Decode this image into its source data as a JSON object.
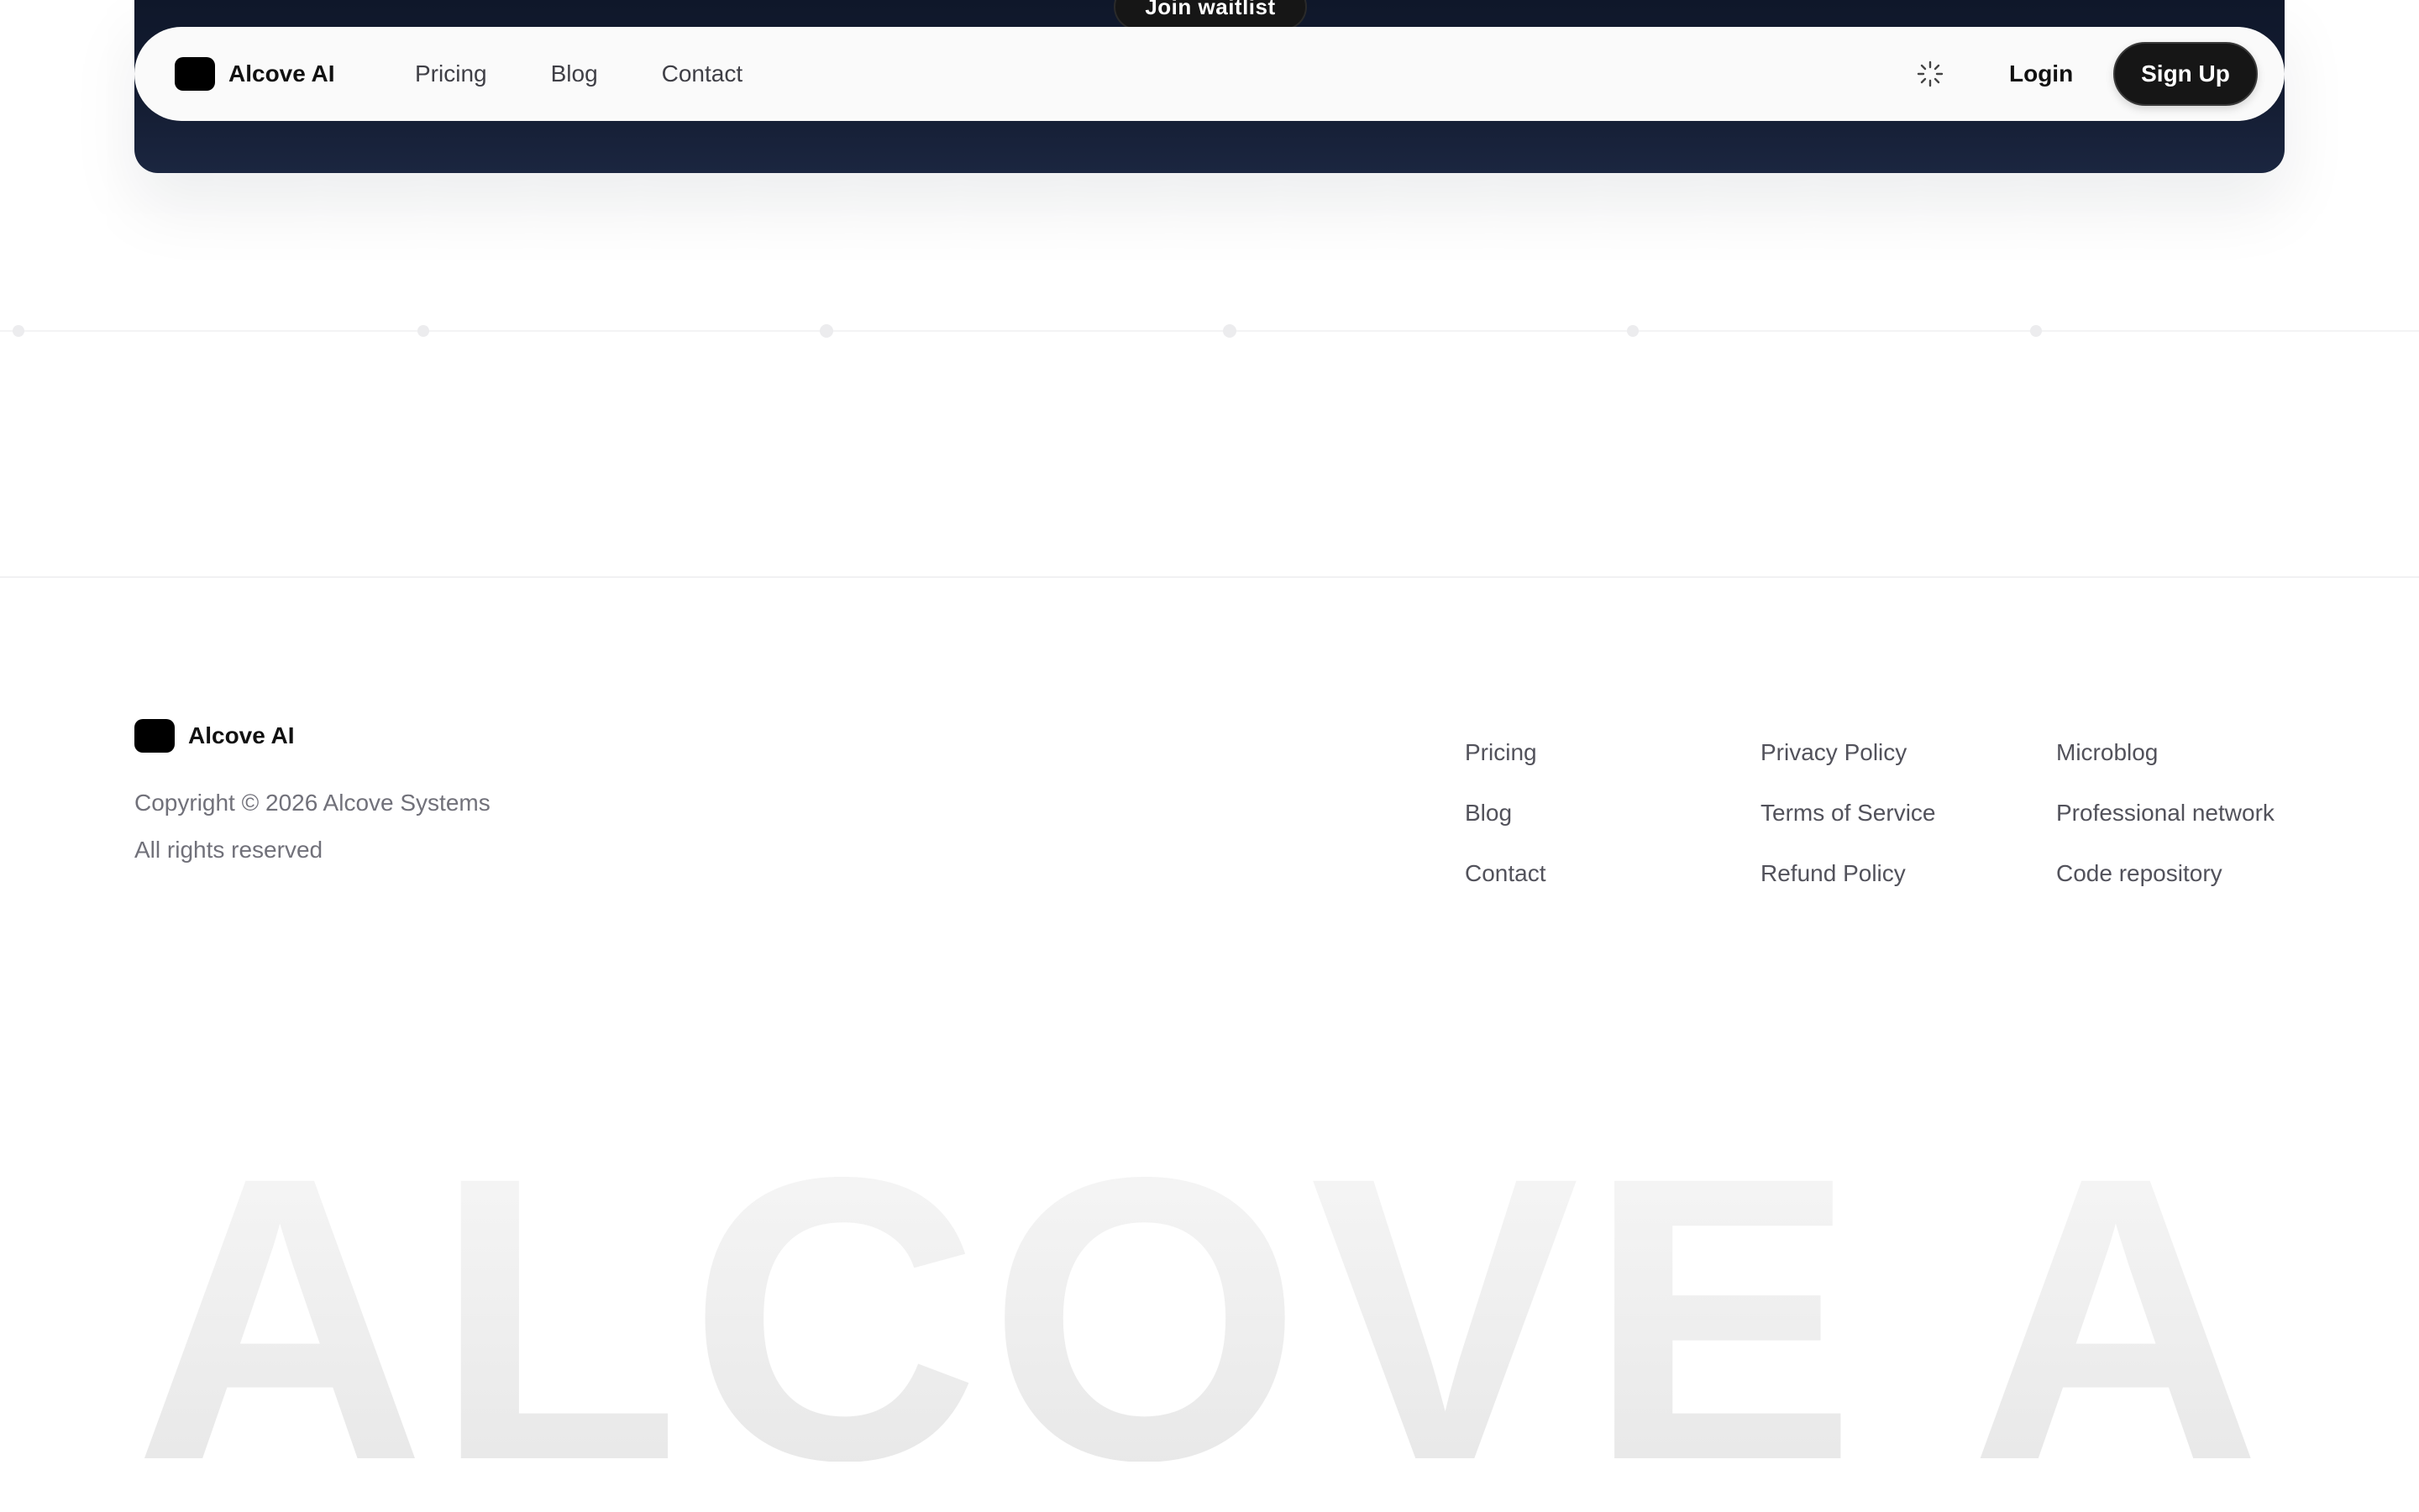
{
  "hero": {
    "waitlist_label": "Join waitlist"
  },
  "navbar": {
    "brand": "Alcove AI",
    "links": [
      "Pricing",
      "Blog",
      "Contact"
    ],
    "login_label": "Login",
    "signup_label": "Sign Up",
    "theme_icon": "sun-loader-icon"
  },
  "footer": {
    "brand": "Alcove AI",
    "copyright": "Copyright © 2026 Alcove Systems",
    "rights": "All rights reserved",
    "columns": [
      [
        "Pricing",
        "Blog",
        "Contact"
      ],
      [
        "Privacy Policy",
        "Terms of Service",
        "Refund Policy"
      ],
      [
        "Microblog",
        "Professional network",
        "Code repository"
      ]
    ]
  },
  "watermark": "ALCOVE AI",
  "colors": {
    "hero_bg": "#0f172a",
    "button_bg": "#161616",
    "text_muted": "#71717a"
  }
}
